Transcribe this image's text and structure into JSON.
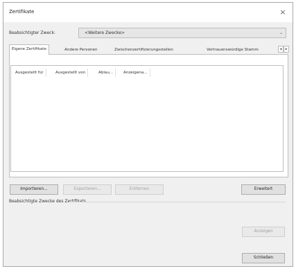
{
  "window": {
    "title": "Zertifikate",
    "close_glyph": "×"
  },
  "purpose": {
    "label": "Beabsichtigter Zweck:",
    "value": "<Weitere Zwecke>",
    "arrow": "⌄"
  },
  "tabs": [
    {
      "label": "Eigene Zertifikate",
      "active": true
    },
    {
      "label": "Andere Personen",
      "active": false
    },
    {
      "label": "Zwischenzertifizierungsstellen",
      "active": false
    },
    {
      "label": "Vertrauenswürdige Stamm",
      "active": false
    }
  ],
  "tab_scroll": {
    "left": "◂",
    "right": "▸"
  },
  "list": {
    "columns": [
      "Ausgestellt für",
      "Ausgestellt von",
      "Ablau...",
      "Anzeigena..."
    ],
    "rows": []
  },
  "buttons": {
    "import": "Importieren...",
    "export": "Exportieren...",
    "remove": "Entfernen",
    "advanced": "Erweitert",
    "view": "Anzeigen",
    "close": "Schließen"
  },
  "purposes_section": {
    "label": "Beabsichtigte Zwecke des Zertifikats"
  },
  "icons": {
    "close": "close-icon",
    "dropdown": "chevron-down-icon",
    "scroll_left": "chevron-left-icon",
    "scroll_right": "chevron-right-icon"
  },
  "colors": {
    "dialog_bg": "#f0f0f0",
    "border": "#a8a8a8",
    "button_bg": "#e1e1e1",
    "disabled_text": "#a0a0a0"
  }
}
